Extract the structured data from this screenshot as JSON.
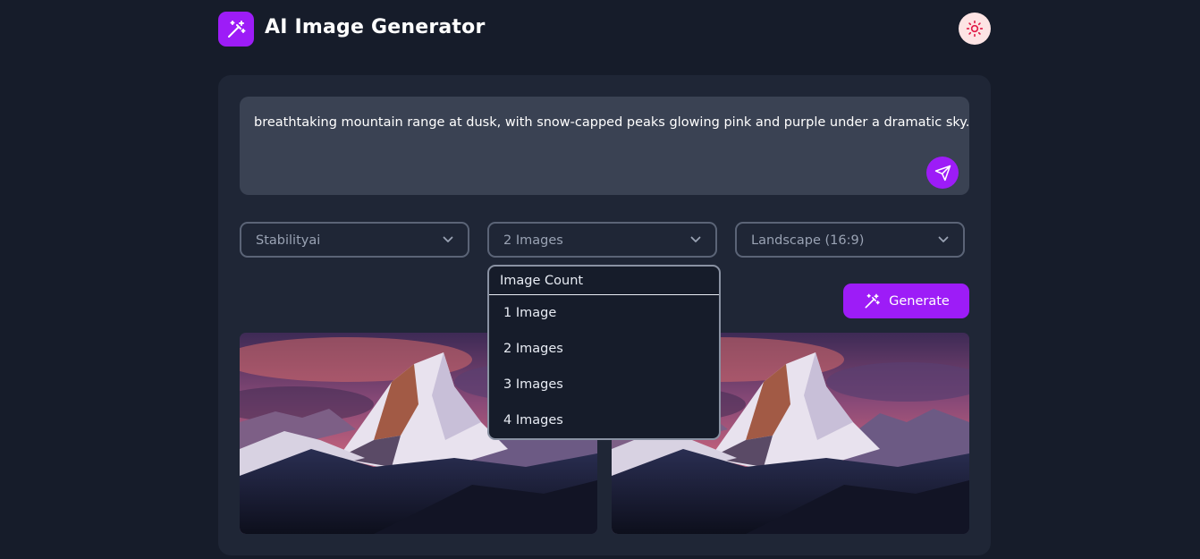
{
  "header": {
    "title": "AI Image Generator",
    "logo_icon": "magic-wand-icon",
    "theme_icon": "sun-icon"
  },
  "prompt": {
    "text": "breathtaking mountain range at dusk, with snow-capped peaks glowing pink and purple under a dramatic sky.",
    "send_icon": "send-icon"
  },
  "controls": {
    "model": {
      "value": "Stabilityai"
    },
    "count": {
      "value": "2 Images"
    },
    "ratio": {
      "value": "Landscape (16:9)"
    },
    "generate_label": "Generate",
    "generate_icon": "magic-wand-icon"
  },
  "count_dropdown": {
    "open": true,
    "header": "Image Count",
    "options": [
      "1 Image",
      "2 Images",
      "3 Images",
      "4 Images"
    ]
  },
  "results": {
    "images": [
      {
        "subject": "mountain-landscape-image"
      },
      {
        "subject": "mountain-landscape-image"
      }
    ]
  },
  "colors": {
    "background": "#161c2a",
    "card": "#1f2636",
    "input": "#3a4253",
    "accent": "#9d1cf7",
    "theme_toggle_bg": "#fde4e4",
    "theme_toggle_icon": "#e11d48"
  }
}
